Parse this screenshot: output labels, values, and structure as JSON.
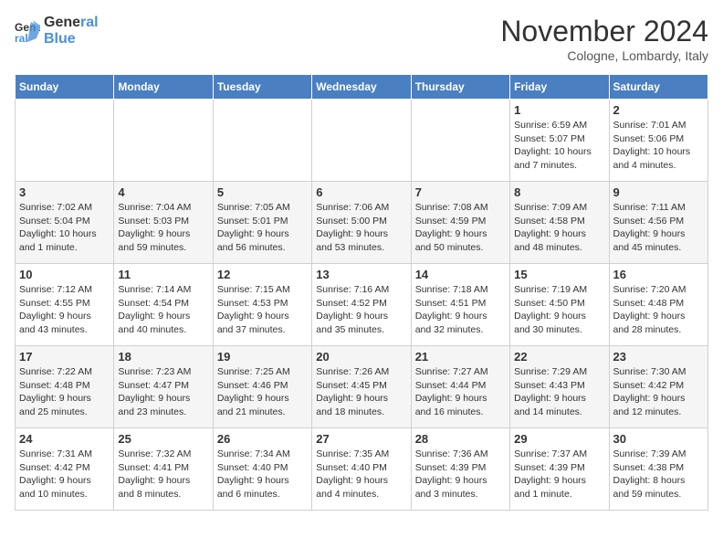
{
  "header": {
    "logo_line1": "General",
    "logo_line2": "Blue",
    "month": "November 2024",
    "location": "Cologne, Lombardy, Italy"
  },
  "weekdays": [
    "Sunday",
    "Monday",
    "Tuesday",
    "Wednesday",
    "Thursday",
    "Friday",
    "Saturday"
  ],
  "weeks": [
    [
      {
        "day": "",
        "info": ""
      },
      {
        "day": "",
        "info": ""
      },
      {
        "day": "",
        "info": ""
      },
      {
        "day": "",
        "info": ""
      },
      {
        "day": "",
        "info": ""
      },
      {
        "day": "1",
        "info": "Sunrise: 6:59 AM\nSunset: 5:07 PM\nDaylight: 10 hours\nand 7 minutes."
      },
      {
        "day": "2",
        "info": "Sunrise: 7:01 AM\nSunset: 5:06 PM\nDaylight: 10 hours\nand 4 minutes."
      }
    ],
    [
      {
        "day": "3",
        "info": "Sunrise: 7:02 AM\nSunset: 5:04 PM\nDaylight: 10 hours\nand 1 minute."
      },
      {
        "day": "4",
        "info": "Sunrise: 7:04 AM\nSunset: 5:03 PM\nDaylight: 9 hours\nand 59 minutes."
      },
      {
        "day": "5",
        "info": "Sunrise: 7:05 AM\nSunset: 5:01 PM\nDaylight: 9 hours\nand 56 minutes."
      },
      {
        "day": "6",
        "info": "Sunrise: 7:06 AM\nSunset: 5:00 PM\nDaylight: 9 hours\nand 53 minutes."
      },
      {
        "day": "7",
        "info": "Sunrise: 7:08 AM\nSunset: 4:59 PM\nDaylight: 9 hours\nand 50 minutes."
      },
      {
        "day": "8",
        "info": "Sunrise: 7:09 AM\nSunset: 4:58 PM\nDaylight: 9 hours\nand 48 minutes."
      },
      {
        "day": "9",
        "info": "Sunrise: 7:11 AM\nSunset: 4:56 PM\nDaylight: 9 hours\nand 45 minutes."
      }
    ],
    [
      {
        "day": "10",
        "info": "Sunrise: 7:12 AM\nSunset: 4:55 PM\nDaylight: 9 hours\nand 43 minutes."
      },
      {
        "day": "11",
        "info": "Sunrise: 7:14 AM\nSunset: 4:54 PM\nDaylight: 9 hours\nand 40 minutes."
      },
      {
        "day": "12",
        "info": "Sunrise: 7:15 AM\nSunset: 4:53 PM\nDaylight: 9 hours\nand 37 minutes."
      },
      {
        "day": "13",
        "info": "Sunrise: 7:16 AM\nSunset: 4:52 PM\nDaylight: 9 hours\nand 35 minutes."
      },
      {
        "day": "14",
        "info": "Sunrise: 7:18 AM\nSunset: 4:51 PM\nDaylight: 9 hours\nand 32 minutes."
      },
      {
        "day": "15",
        "info": "Sunrise: 7:19 AM\nSunset: 4:50 PM\nDaylight: 9 hours\nand 30 minutes."
      },
      {
        "day": "16",
        "info": "Sunrise: 7:20 AM\nSunset: 4:48 PM\nDaylight: 9 hours\nand 28 minutes."
      }
    ],
    [
      {
        "day": "17",
        "info": "Sunrise: 7:22 AM\nSunset: 4:48 PM\nDaylight: 9 hours\nand 25 minutes."
      },
      {
        "day": "18",
        "info": "Sunrise: 7:23 AM\nSunset: 4:47 PM\nDaylight: 9 hours\nand 23 minutes."
      },
      {
        "day": "19",
        "info": "Sunrise: 7:25 AM\nSunset: 4:46 PM\nDaylight: 9 hours\nand 21 minutes."
      },
      {
        "day": "20",
        "info": "Sunrise: 7:26 AM\nSunset: 4:45 PM\nDaylight: 9 hours\nand 18 minutes."
      },
      {
        "day": "21",
        "info": "Sunrise: 7:27 AM\nSunset: 4:44 PM\nDaylight: 9 hours\nand 16 minutes."
      },
      {
        "day": "22",
        "info": "Sunrise: 7:29 AM\nSunset: 4:43 PM\nDaylight: 9 hours\nand 14 minutes."
      },
      {
        "day": "23",
        "info": "Sunrise: 7:30 AM\nSunset: 4:42 PM\nDaylight: 9 hours\nand 12 minutes."
      }
    ],
    [
      {
        "day": "24",
        "info": "Sunrise: 7:31 AM\nSunset: 4:42 PM\nDaylight: 9 hours\nand 10 minutes."
      },
      {
        "day": "25",
        "info": "Sunrise: 7:32 AM\nSunset: 4:41 PM\nDaylight: 9 hours\nand 8 minutes."
      },
      {
        "day": "26",
        "info": "Sunrise: 7:34 AM\nSunset: 4:40 PM\nDaylight: 9 hours\nand 6 minutes."
      },
      {
        "day": "27",
        "info": "Sunrise: 7:35 AM\nSunset: 4:40 PM\nDaylight: 9 hours\nand 4 minutes."
      },
      {
        "day": "28",
        "info": "Sunrise: 7:36 AM\nSunset: 4:39 PM\nDaylight: 9 hours\nand 3 minutes."
      },
      {
        "day": "29",
        "info": "Sunrise: 7:37 AM\nSunset: 4:39 PM\nDaylight: 9 hours\nand 1 minute."
      },
      {
        "day": "30",
        "info": "Sunrise: 7:39 AM\nSunset: 4:38 PM\nDaylight: 8 hours\nand 59 minutes."
      }
    ]
  ]
}
